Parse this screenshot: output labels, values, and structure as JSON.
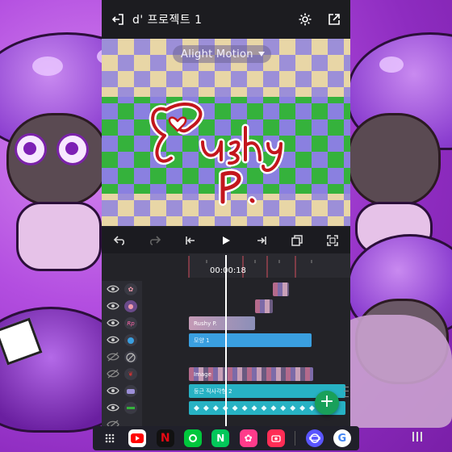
{
  "project": {
    "title": "d' 프로젝트 1"
  },
  "preview": {
    "watermark": "Alight Motion"
  },
  "timeline": {
    "timecode": "00:00:18"
  },
  "tracks": [
    {
      "name": "track-sticker-1",
      "label": ""
    },
    {
      "name": "track-sticker-2",
      "label": ""
    },
    {
      "name": "track-text",
      "label": "Rushy P."
    },
    {
      "name": "track-shape",
      "label": "모양 1"
    },
    {
      "name": "track-hidden",
      "label": ""
    },
    {
      "name": "track-image",
      "label": "Image"
    },
    {
      "name": "track-rect",
      "label": "둥근 직사각형 2"
    },
    {
      "name": "track-diamonds",
      "label": ""
    }
  ],
  "dock": {
    "apps": [
      {
        "name": "apps-grid-icon",
        "color": "#20202a"
      },
      {
        "name": "youtube-icon",
        "color": "#ff0000"
      },
      {
        "name": "netflix-icon",
        "color": "#111111"
      },
      {
        "name": "webtoon-icon",
        "color": "#00c73c"
      },
      {
        "name": "naver-icon",
        "color": "#03c75a"
      },
      {
        "name": "flower-app-icon",
        "color": "#ff3b8b"
      },
      {
        "name": "camera-app-icon",
        "color": "#ff2d55"
      },
      {
        "name": "samsung-internet-icon",
        "color": "#5a55ff"
      },
      {
        "name": "google-icon",
        "color": "#ffffff"
      }
    ]
  },
  "colors": {
    "accent": "#19a05a",
    "clip_blue": "#3a9fe0",
    "clip_teal": "#27b2c4"
  }
}
